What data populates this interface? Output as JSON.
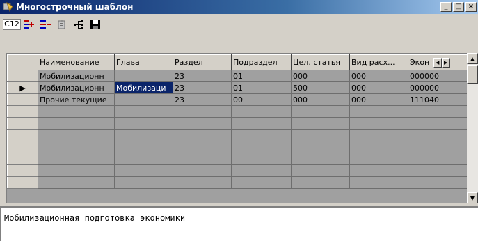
{
  "window": {
    "title": "Многострочный шаблон",
    "buttons": {
      "minimize": "_",
      "maximize": "□",
      "close": "×"
    }
  },
  "toolbar": {
    "items": [
      {
        "label": "C12",
        "icon": "c12-text-icon"
      },
      {
        "icon": "insert-row-icon"
      },
      {
        "icon": "delete-row-icon"
      },
      {
        "icon": "clipboard-icon"
      },
      {
        "icon": "tree-icon"
      },
      {
        "icon": "save-disk-icon"
      }
    ]
  },
  "grid": {
    "columns": [
      "Наименование",
      "Глава",
      "Раздел",
      "Подраздел",
      "Цел. статья",
      "Вид расх...",
      "Экон"
    ],
    "rows": [
      [
        "Мобилизационн",
        "",
        "23",
        "01",
        "000",
        "000",
        "000000"
      ],
      [
        "Мобилизационн",
        "Мобилизаци",
        "23",
        "01",
        "500",
        "000",
        "000000"
      ],
      [
        "Прочие текущие",
        "",
        "23",
        "00",
        "000",
        "000",
        "111040"
      ],
      [
        "",
        "",
        "",
        "",
        "",
        "",
        ""
      ],
      [
        "",
        "",
        "",
        "",
        "",
        "",
        ""
      ],
      [
        "",
        "",
        "",
        "",
        "",
        "",
        ""
      ],
      [
        "",
        "",
        "",
        "",
        "",
        "",
        ""
      ],
      [
        "",
        "",
        "",
        "",
        "",
        "",
        ""
      ],
      [
        "",
        "",
        "",
        "",
        "",
        "",
        ""
      ],
      [
        "",
        "",
        "",
        "",
        "",
        "",
        ""
      ]
    ],
    "current_row_marker": "▶"
  },
  "memo": {
    "text": "Мобилизационная подготовка экономики"
  },
  "colors": {
    "title_start": "#0a246a",
    "title_end": "#a6caf0",
    "selection": "#0a246a",
    "grid_bg": "#a0a0a0",
    "face": "#d4d0c8"
  }
}
